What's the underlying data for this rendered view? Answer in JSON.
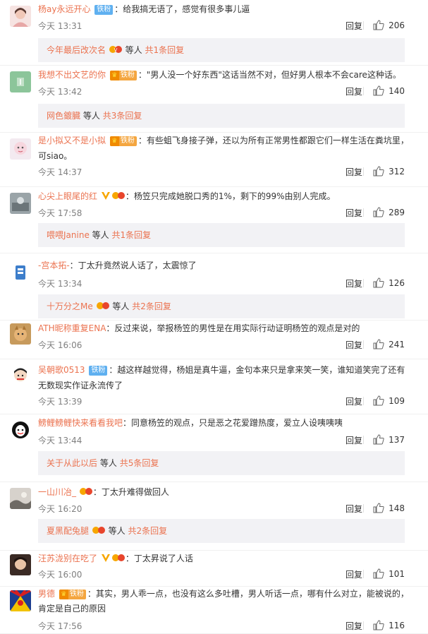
{
  "comments": [
    {
      "user": "杨ay永远开心",
      "badge": "铁粉",
      "text": "：给我搞无语了，感觉有很多事儿逼",
      "time": "今天 13:31",
      "reply_label": "回复",
      "likes": "206",
      "sub": {
        "user": "今年最后改次名",
        "suffix": "等人",
        "count": "共1条回复"
      }
    },
    {
      "user": "我想不出文艺的你",
      "badge": "铁粉",
      "text": "：\"男人没一个好东西\"这话当然不对，但好男人根本不会care这种话。",
      "time": "今天 13:42",
      "reply_label": "回复",
      "likes": "140",
      "sub": {
        "user": "网色鍍臓",
        "suffix": "等人",
        "count": "共3条回复"
      }
    },
    {
      "user": "是小拟又不是小拟",
      "badge": "铁粉",
      "text": "：有些蛆飞身接子弹，还以为所有正常男性都跟它们一样生活在粪坑里，可siao。",
      "time": "今天 14:37",
      "reply_label": "回复",
      "likes": "312"
    },
    {
      "user": "心尖上眼尾的红",
      "text": "：杨笠只完成她脱口秀的1%，剩下的99%由别人完成。",
      "time": "今天 17:58",
      "reply_label": "回复",
      "likes": "289",
      "sub": {
        "user": "喂喂Janine",
        "suffix": "等人",
        "count": "共1条回复"
      }
    },
    {
      "user": "-宫本拓-",
      "text": "：丁太升竟然说人话了，太震惊了",
      "time": "今天 13:34",
      "reply_label": "回复",
      "likes": "126",
      "sub": {
        "user": "十万分之Me",
        "suffix": "等人",
        "count": "共2条回复"
      }
    },
    {
      "user": "ATH昵称重复ENA",
      "text": "：反过来说，举报杨笠的男性是在用实际行动证明杨笠的观点是对的",
      "time": "今天 16:06",
      "reply_label": "回复",
      "likes": "241"
    },
    {
      "user": "吴朝歌0513",
      "badge": "铁粉",
      "text": "：越这样越觉得，杨姐是真牛逼，金句本来只是拿来笑一笑，谁知道笑完了还有无数现实作证永流传了",
      "time": "今天 13:39",
      "reply_label": "回复",
      "likes": "109"
    },
    {
      "user": "鳑鲤鳑鲤快来看看我吧",
      "text": "：同意杨笠的观点，只是恶之花爱蹭热度，爱立人设咦咦咦",
      "time": "今天 13:44",
      "reply_label": "回复",
      "likes": "137",
      "sub": {
        "user": "关于从此以后",
        "suffix": "等人",
        "count": "共5条回复"
      }
    },
    {
      "user": "一山川冶_",
      "text": "：丁太升难得做回人",
      "time": "今天 16:20",
      "reply_label": "回复",
      "likes": "148",
      "sub": {
        "user": "夏黑配兔腿",
        "suffix": "等人",
        "count": "共2条回复"
      }
    },
    {
      "user": "汪苏泷别在吃了",
      "text": "：丁太昇说了人话",
      "time": "今天 16:00",
      "reply_label": "回复",
      "likes": "101"
    },
    {
      "user": "男德",
      "badge": "铁粉",
      "text": "：其实，男人乖一点，也没有这么多吐槽，男人听话一点，哪有什么对立，能被说的，肯定是自己的原因",
      "time": "今天 17:56",
      "reply_label": "回复",
      "likes": "116"
    }
  ],
  "colors": {
    "username": "#eb7350",
    "fan_badge": "#5fb0f0",
    "vip_badge": "#f4a640",
    "sub_bg": "#f2f2f5",
    "time": "#808080"
  }
}
